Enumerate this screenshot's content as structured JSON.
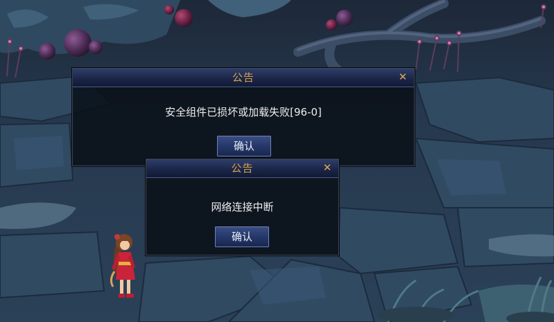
{
  "dialogs": [
    {
      "title": "公告",
      "close_glyph": "✕",
      "message": "安全组件已损坏或加载失败[96-0]",
      "button_label": "确认"
    },
    {
      "title": "公告",
      "close_glyph": "✕",
      "message": "网络连接中断",
      "button_label": "确认"
    }
  ],
  "colors": {
    "title_text": "#d9a24a",
    "close_icon": "#dfa75a",
    "message_text": "#eeeeee",
    "button_bg": "#25386a",
    "dialog_bg": "#080e16"
  }
}
